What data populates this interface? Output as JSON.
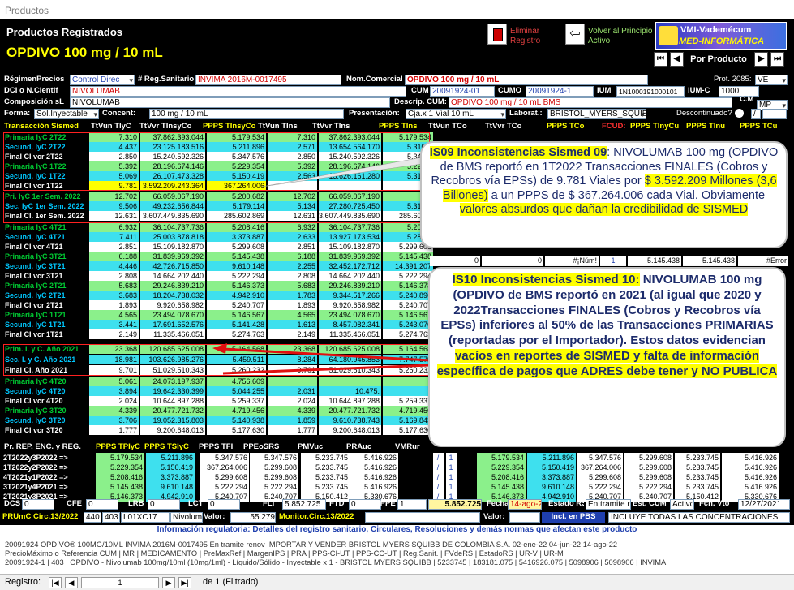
{
  "window": {
    "title": "Productos"
  },
  "header": {
    "title": "Productos Registrados",
    "product": "OPDIVO 100 mg / 10 mL",
    "delete_label": "Eliminar Registro",
    "back_label": "Volver al Principio Activo",
    "logo_line1": "VMI-Vademécum",
    "logo_line2": "MED-INFORMÁTICA",
    "sort_label": "Por Producto"
  },
  "fields": {
    "regimen_label": "RégimenPrecios",
    "regimen_value": "Control Direc",
    "reg_label": "# Reg.Sanitario",
    "reg_value": "INVIMA 2016M-0017495",
    "nomcom_label": "Nom.Comercial",
    "nomcom_value": "OPDIVO 100 mg / 10 mL",
    "prot_label": "Prot. 2085:",
    "prot_value": "VE",
    "dci_label": "DCI o N.Cientif",
    "dci_value": "NIVOLUMAB",
    "cum_label": "CUM",
    "cum_value": "20091924-01",
    "cumo_label": "CUMO",
    "cumo_value": "20091924-1",
    "ium_label": "IUM",
    "ium_value": "1N1000191000101",
    "iumc_label": "IUM-C",
    "iumc_value": "1000",
    "comp_label": "Composición sL",
    "comp_value": "NIVOLUMAB",
    "desc_label": "Descrip. CUM:",
    "desc_value": "OPDIVO 100 mg / 10 mL BMS",
    "cm_label": "C.M",
    "cm_value": "MP",
    "forma_label": "Forma:",
    "forma_value": "Sol.Inyectable",
    "concent_label": "Concent:",
    "concent_value": "100 mg / 10 mL",
    "present_label": "Presentación:",
    "present_value": "Cja.x 1 Vial 10 mL",
    "labor_label": "Laborat.:",
    "labor_value": "BRISTOL_MYERS_SQUIBB",
    "desc2_label": "Descontinuado?",
    "desc2_value": "/"
  },
  "grid_headers": [
    "Transacción Sismed",
    "TtVun TlyC",
    "TtVvr TInsyCo",
    "PPPS TInsyCo",
    "TtVun TIns",
    "TtVvr TIns",
    "PPPS TIns",
    "TtVun TCo",
    "TtVvr TCo",
    "PPPS TCo",
    "FCUD:",
    "PPPS TInyCu",
    "PPPS TInu",
    "PPPS TCu"
  ],
  "rows": [
    {
      "n": "Primaria IyC 2T22",
      "t": "p",
      "v": [
        "7.310",
        "37.862.393.044",
        "5.179.534",
        "7.310",
        "37.862.393.044",
        "5.179.534"
      ]
    },
    {
      "n": "Secund. IyC 2T22",
      "t": "s",
      "v": [
        "4.437",
        "23.125.183.516",
        "5.211.896",
        "2.571",
        "13.654.564.170",
        "5.310.9"
      ]
    },
    {
      "n": "Final CI vcr 2T22",
      "t": "f",
      "v": [
        "2.850",
        "15.240.592.326",
        "5.347.576",
        "2.850",
        "15.240.592.326",
        "5.347.5"
      ]
    },
    {
      "n": "Primaria IyC 1T22",
      "t": "p",
      "v": [
        "5.392",
        "28.196.674.146",
        "5.229.354",
        "5.392",
        "28.196.674.146",
        "5.229.3"
      ]
    },
    {
      "n": "Secund. IyC 1T22",
      "t": "s",
      "v": [
        "5.069",
        "26.107.473.328",
        "5.150.419",
        "2.563",
        "13.626.161.280",
        "5.316.4"
      ]
    },
    {
      "n": "Final CI vcr 1T22",
      "t": "f",
      "hl": true,
      "v": [
        "9.781",
        "3.592.209.243.364",
        "367.264.006",
        "",
        "",
        ""
      ]
    },
    {
      "n": "Pri. IyC 1er Sem. 2022",
      "t": "p",
      "v": [
        "12.702",
        "66.059.067.190",
        "5.200.682",
        "12.702",
        "66.059.067.190",
        ""
      ]
    },
    {
      "n": "Sec. IyC 1er Sem. 2022",
      "t": "s",
      "v": [
        "9.506",
        "49.232.656.844",
        "5.179.114",
        "5.134",
        "27.280.725.450",
        "5.313.7"
      ]
    },
    {
      "n": "Final CI. 1er Sem. 2022",
      "t": "f",
      "v": [
        "12.631",
        "3.607.449.835.690",
        "285.602.869",
        "12.631",
        "3.607.449.835.690",
        "285.602.8"
      ]
    },
    {
      "n": "Primaria IyC 4T21",
      "t": "p",
      "v": [
        "6.932",
        "36.104.737.736",
        "5.208.416",
        "6.932",
        "36.104.737.736",
        "5.208.4"
      ]
    },
    {
      "n": "Secund. IyC 4T21",
      "t": "s",
      "v": [
        "7.411",
        "25.003.878.818",
        "3.373.887",
        "2.633",
        "13.927.173.534",
        "5.289.4"
      ]
    },
    {
      "n": "Final CI vcr 4T21",
      "t": "f",
      "v": [
        "2.851",
        "15.109.182.870",
        "5.299.608",
        "2.851",
        "15.109.182.870",
        "5.299.608"
      ]
    },
    {
      "n": "Primaria IyC 3T21",
      "t": "p",
      "v": [
        "6.188",
        "31.839.969.392",
        "5.145.438",
        "6.188",
        "31.839.969.392",
        "5.145.438"
      ]
    },
    {
      "n": "Secund. IyC 3T21",
      "t": "s",
      "v": [
        "4.446",
        "42.726.715.850",
        "9.610.148",
        "2.255",
        "32.452.172.712",
        "14.391.207"
      ]
    },
    {
      "n": "Final CI vcr 3T21",
      "t": "f",
      "v": [
        "2.808",
        "14.664.202.440",
        "5.222.294",
        "2.808",
        "14.664.202.440",
        "5.222.294"
      ]
    },
    {
      "n": "Primaria IyC 2T21",
      "t": "p",
      "v": [
        "5.683",
        "29.246.839.210",
        "5.146.373",
        "5.683",
        "29.246.839.210",
        "5.146.373"
      ]
    },
    {
      "n": "Secund. IyC 2T21",
      "t": "s",
      "v": [
        "3.683",
        "18.204.738.032",
        "4.942.910",
        "1.783",
        "9.344.517.266",
        "5.240.896"
      ]
    },
    {
      "n": "Final CI vcr 2T21",
      "t": "f",
      "v": [
        "1.893",
        "9.920.658.982",
        "5.240.707",
        "1.893",
        "9.920.658.982",
        "5.240.707"
      ]
    },
    {
      "n": "Primaria IyC 1T21",
      "t": "p",
      "v": [
        "4.565",
        "23.494.078.670",
        "5.146.567",
        "4.565",
        "23.494.078.670",
        "5.146.567"
      ]
    },
    {
      "n": "Secund. IyC 1T21",
      "t": "s",
      "v": [
        "3.441",
        "17.691.652.576",
        "5.141.428",
        "1.613",
        "8.457.082.341",
        "5.243.076"
      ]
    },
    {
      "n": "Final CI vcr 1T21",
      "t": "f",
      "v": [
        "2.149",
        "11.335.466.051",
        "5.274.763",
        "2.149",
        "11.335.466.051",
        "5.274.763"
      ]
    },
    {
      "n": "Prim. I. y C. Año 2021",
      "t": "p",
      "v": [
        "23.368",
        "120.685.625.008",
        "5.164.568",
        "23.368",
        "120.685.625.008",
        "5.164.568"
      ]
    },
    {
      "n": "Sec. I. y C. Año 2021",
      "t": "s",
      "v": [
        "18.981",
        "103.626.985.276",
        "5.459.511",
        "8.284",
        "64.180.945.853",
        "7.747.579"
      ]
    },
    {
      "n": "Final CI. Año 2021",
      "t": "f",
      "v": [
        "9.701",
        "51.029.510.343",
        "5.260.232",
        "9.701",
        "51.029.510.343",
        "5.260.232"
      ]
    },
    {
      "n": "Primaria IyC 4T20",
      "t": "p",
      "v": [
        "5.061",
        "24.073.197.937",
        "4.756.609",
        "",
        "",
        ""
      ]
    },
    {
      "n": "Secund. IyC 4T20",
      "t": "s",
      "v": [
        "3.894",
        "19.642.330.399",
        "5.044.255",
        "2.031",
        "10.475.",
        ""
      ]
    },
    {
      "n": "Final CI vcr 4T20",
      "t": "f",
      "v": [
        "2.024",
        "10.644.897.288",
        "5.259.337",
        "2.024",
        "10.644.897.288",
        "5.259.337"
      ]
    },
    {
      "n": "Primaria IyC 3T20",
      "t": "p",
      "v": [
        "4.339",
        "20.477.721.732",
        "4.719.456",
        "4.339",
        "20.477.721.732",
        "4.719.456"
      ]
    },
    {
      "n": "Secund. IyC 3T20",
      "t": "s",
      "v": [
        "3.706",
        "19.052.315.803",
        "5.140.938",
        "1.859",
        "9.610.738.743",
        "5.169.843"
      ]
    },
    {
      "n": "Final CI vcr 3T20",
      "t": "f",
      "v": [
        "1.777",
        "9.200.648.013",
        "5.177.630",
        "1.777",
        "9.200.648.013",
        "5.177.630"
      ]
    }
  ],
  "mid_extra": {
    "r1_zero1": "0",
    "r1_zero2": "0",
    "r1_num": "#¡Núm!",
    "r1_one": "1",
    "r1_a": "5.145.438",
    "r1_b": "5.145.438",
    "r1_err": "#Error"
  },
  "callout1": {
    "title": "IS09 Inconsistencias Sismed 09",
    "t1": "NIVOLUMAB 100 mg (OPDIVO de BMS reportó en 1T2022 Transacciones FINALES (Cobros y Recobros vía EPSs) de 9.781 Viales por",
    "h1": "$ 3.592.209 Millones (3,6 Billones)",
    "t2": "a un PPPS de $ 367.264.006 cada Vial. Obviamente",
    "h2": "valores absurdos que dañan la credibilidad de SISMED"
  },
  "callout2": {
    "title": "IS10 Inconsistencias Sismed 10:",
    "t1": "NIVOLUMAB 100 mg (OPDIVO de BMS reportó en 2021 (al igual que 2020 y 2022Transacciones FINALES (Cobros y Recobros vía EPSs) inferiores al 50% de las Transacciones PRIMARIAS (reportadas por el Importador). Estos datos evidencian",
    "h1": "vacíos en reportes de SISMED y falta de información específica de pagos que ADRES debe tener y NO PUBLICA"
  },
  "bottom_headers": [
    "Pr. REP. ENC. y REG.",
    "PPPS TPIyC",
    "PPPS TSIyC",
    "PPPS TFI",
    "PPEoSRS",
    "PMVuc",
    "PRAuc",
    "VMRur"
  ],
  "bottom_rows": [
    {
      "n": "2T2022y3P2022 =>",
      "v": [
        "5.179.534",
        "5.211.896",
        "5.347.576",
        "5.347.576",
        "5.233.745",
        "5.416.926"
      ],
      "r": [
        "/",
        "1",
        "5.179.534",
        "5.211.896",
        "5.347.576",
        "5.299.608",
        "5.233.745",
        "5.416.926"
      ]
    },
    {
      "n": "1T2022y2P2022 =>",
      "v": [
        "5.229.354",
        "5.150.419",
        "367.264.006",
        "5.299.608",
        "5.233.745",
        "5.416.926"
      ],
      "r": [
        "/",
        "1",
        "5.229.354",
        "5.150.419",
        "367.264.006",
        "5.299.608",
        "5.233.745",
        "5.416.926"
      ]
    },
    {
      "n": "4T2021y1P2022 =>",
      "v": [
        "5.208.416",
        "3.373.887",
        "5.299.608",
        "5.299.608",
        "5.233.745",
        "5.416.926"
      ],
      "r": [
        "/",
        "1",
        "5.208.416",
        "3.373.887",
        "5.299.608",
        "5.299.608",
        "5.233.745",
        "5.416.926"
      ]
    },
    {
      "n": "3T2021y4P2021 =>",
      "v": [
        "5.145.438",
        "9.610.148",
        "5.222.294",
        "5.222.294",
        "5.233.745",
        "5.416.926"
      ],
      "r": [
        "/",
        "1",
        "5.145.438",
        "9.610.148",
        "5.222.294",
        "5.222.294",
        "5.233.745",
        "5.416.926"
      ]
    },
    {
      "n": "2T2021y3P2021 =>",
      "v": [
        "5.146.373",
        "4.942.910",
        "5.240.707",
        "5.240.707",
        "5.150.412",
        "5.330.676"
      ],
      "r": [
        "/",
        "1",
        "5.146.373",
        "4.942.910",
        "5.240.707",
        "5.240.707",
        "5.150.412",
        "5.330.676"
      ]
    }
  ],
  "status_line1": {
    "dcs": "DCS",
    "dcs_v": "0",
    "cfe": "CFE",
    "cfe_v": "0",
    "lrb": "LRB",
    "lrb_v": "0",
    "lct": "LCT",
    "lct_v": "0",
    "fli": "FLI",
    "fli_v": "5.852.725",
    "ftd": "FTD",
    "ftd_v": "0",
    "fcppe": "FCPPE",
    "fcppe_v": "1",
    "val": "5.852.725",
    "fecha": "Fecha",
    "fecha_v": "14-ago-22",
    "estado": "Estado RS",
    "estado_v": "En tramite renov",
    "est_cum": "Est. CUM",
    "est_cum_v": "Activo",
    "fch": "Fch. Vto",
    "fch_v": "12/27/2021"
  },
  "status_line2": {
    "prumc": "PRUmC Circ.13/2022",
    "p1": "440",
    "p2": "403",
    "p3": "L01XC17",
    "p4": "Nivolum",
    "valor": "Valor:",
    "valor_v": "55.279",
    "monitor": "Monitor.Circ.13/2022",
    "valor2": "Valor:",
    "incl": "Incl. en PBS",
    "incl_v": "INCLUYE TODAS LAS CONCENTRACIONES"
  },
  "info_bar": "Información regulatoria: Detalles del registro sanitario, Circulares, Resoluciones y demás normas que afectan este producto",
  "footer": {
    "line1": "20091924 OPDIVO® 100MG/10ML INVIMA 2016M-0017495 En tramite renov   IMPORTAR Y VENDER BRISTOL MYERS SQUIBB DE COLOMBIA S.A.  02-ene-22 04-jun-22 14-ago-22",
    "line2": "PrecioMáximo o Referencia CUM | MR | MEDICAMENTO | PreMaxRef | MargenIPS | PRA | PPS-CI-UT | PPS-CC-UT | Reg.Sanit. | FVdeRS | EstadoRS | UR-V | UR-M",
    "line3": "20091924-1 | 403 | OPDIVO - Nivolumab 100mg/10ml (10mg/1ml) - Líquido/Sólido - Inyectable x 1 - BRISTOL MYERS SQUIBB | 5233745 | 183181.075 | 5416926.075 | 5098906 | 5098906 | INVIMA"
  },
  "record_nav": {
    "label": "Registro:",
    "current": "1",
    "of": "de  1 (Filtrado)"
  }
}
